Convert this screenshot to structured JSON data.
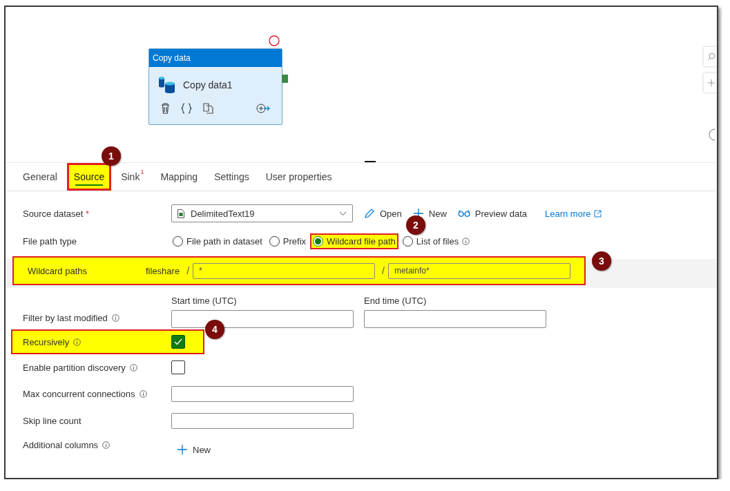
{
  "canvas": {
    "activity": {
      "type_label": "Copy data",
      "name": "Copy data1"
    }
  },
  "tabs": [
    {
      "label": "General",
      "selected": false,
      "highlighted": false
    },
    {
      "label": "Source",
      "selected": true,
      "highlighted": true,
      "callout": "1"
    },
    {
      "label": "Sink",
      "selected": false,
      "highlighted": false,
      "badge": "1"
    },
    {
      "label": "Mapping",
      "selected": false,
      "highlighted": false
    },
    {
      "label": "Settings",
      "selected": false,
      "highlighted": false
    },
    {
      "label": "User properties",
      "selected": false,
      "highlighted": false
    }
  ],
  "source_dataset": {
    "label": "Source dataset",
    "required_mark": "*",
    "value": "DelimitedText19",
    "actions": [
      {
        "kind": "edit",
        "label": "Open"
      },
      {
        "kind": "add",
        "label": "New"
      },
      {
        "kind": "preview",
        "label": "Preview data"
      }
    ],
    "link": "Learn more"
  },
  "file_path_type": {
    "label": "File path type",
    "options": [
      {
        "label": "File path in dataset",
        "selected": false,
        "highlighted": false,
        "info": false
      },
      {
        "label": "Prefix",
        "selected": false,
        "highlighted": false,
        "info": false
      },
      {
        "label": "Wildcard file path",
        "selected": true,
        "highlighted": true,
        "info": false,
        "callout": "2"
      },
      {
        "label": "List of files",
        "selected": false,
        "highlighted": false,
        "info": true
      }
    ]
  },
  "wildcard_paths": {
    "label": "Wildcard paths",
    "highlighted": true,
    "callout": "3",
    "container": "fileshare",
    "parts": [
      {
        "separator": "/",
        "value": "*"
      },
      {
        "separator": "/",
        "value": "metainfo*"
      }
    ]
  },
  "filter_by_last_modified": {
    "label": "Filter by last modified",
    "start_label": "Start time (UTC)",
    "end_label": "End time (UTC)"
  },
  "recursively": {
    "label": "Recursively",
    "checked": true,
    "highlighted": true,
    "callout": "4"
  },
  "partition_discovery": {
    "label": "Enable partition discovery",
    "checked": false
  },
  "max_concurrent_connections": {
    "label": "Max concurrent connections"
  },
  "skip_line_count": {
    "label": "Skip line count"
  },
  "additional_columns": {
    "label": "Additional columns",
    "action": "New"
  }
}
